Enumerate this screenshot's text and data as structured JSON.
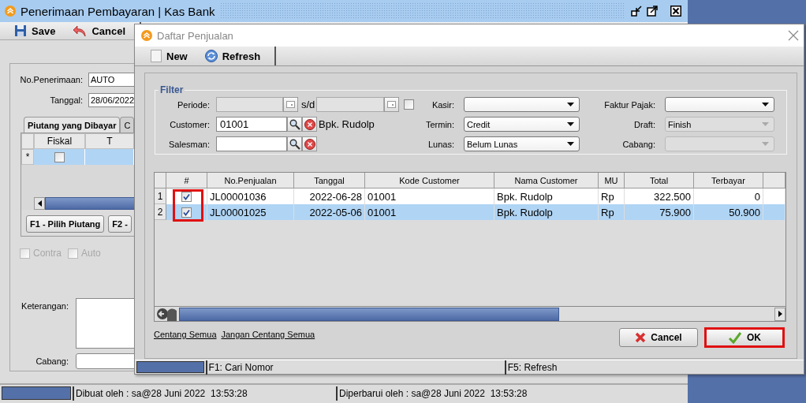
{
  "main_window": {
    "title": "Penerimaan Pembayaran | Kas Bank",
    "toolbar": [
      {
        "kind": "save",
        "label": "Save"
      },
      {
        "kind": "cancel",
        "label": "Cancel"
      }
    ],
    "fields": [
      {
        "label": "No.Penerimaan:",
        "value": "AUTO"
      },
      {
        "label": "Tanggal:",
        "value": "28/06/2022"
      }
    ],
    "tabs": [
      {
        "label": "Piutang yang Dibayar",
        "selected": true
      },
      {
        "label": "C",
        "selected": false
      }
    ],
    "grid": {
      "columns": [
        "Fiskal",
        "T"
      ],
      "rows": [
        {
          "marker": "*",
          "fiskal_checked": false,
          "selected": true
        }
      ]
    },
    "buttons": [
      "F1 - Pilih Piutang",
      "F2 -"
    ],
    "options": [
      {
        "label": "Contra",
        "checked": false,
        "disabled": true
      },
      {
        "label": "Auto",
        "checked": false,
        "disabled": true
      }
    ],
    "keterangan": {
      "label": "Keterangan:"
    },
    "cabang": {
      "label": "Cabang:"
    },
    "status_bar": [
      "Dibuat oleh : sa@28 Juni 2022  13:53:28",
      "Diperbarui oleh : sa@28 Juni 2022  13:53:28"
    ]
  },
  "dialog": {
    "title": "Daftar Penjualan",
    "toolbar": [
      {
        "kind": "new",
        "label": "New"
      },
      {
        "kind": "refresh",
        "label": "Refresh"
      }
    ],
    "filter": {
      "title": "Filter",
      "periode": {
        "label": "Periode:",
        "separator": "s/d",
        "checked": false
      },
      "customer": {
        "label": "Customer:",
        "value": "01001",
        "name": "Bpk. Rudolp"
      },
      "salesman": {
        "label": "Salesman:"
      },
      "combos_middle": [
        {
          "label": "Kasir:",
          "disabled": false
        },
        {
          "label": "Termin:",
          "value": "Credit",
          "disabled": false
        },
        {
          "label": "Lunas:",
          "value": "Belum Lunas",
          "disabled": false
        }
      ],
      "combos_right": [
        {
          "label": "Faktur Pajak:",
          "disabled": false
        },
        {
          "label": "Draft:",
          "value": "Finish",
          "disabled": true
        },
        {
          "label": "Cabang:",
          "disabled": true
        }
      ]
    },
    "table": {
      "check_column": "#",
      "columns": [
        "No.Penjualan",
        "Tanggal",
        "Kode Customer",
        "Nama Customer",
        "MU",
        "Total",
        "Terbayar"
      ],
      "check_column_highlighted": true,
      "rows": [
        {
          "number": "1",
          "checked": true,
          "selected": false,
          "cells": [
            "JL00001036",
            "2022-06-28",
            "01001",
            "Bpk. Rudolp",
            "Rp",
            "322.500",
            "0"
          ]
        },
        {
          "number": "2",
          "checked": true,
          "selected": true,
          "cells": [
            "JL00001025",
            "2022-05-06",
            "01001",
            "Bpk. Rudolp",
            "Rp",
            "75.900",
            "50.900"
          ]
        }
      ]
    },
    "links": [
      "Centang Semua",
      "Jangan Centang Semua"
    ],
    "buttons": [
      {
        "kind": "cancel",
        "label": "Cancel",
        "highlighted": false
      },
      {
        "kind": "ok",
        "label": "OK",
        "highlighted": true
      }
    ],
    "status_bar": [
      "F1: Cari Nomor",
      "F5: Refresh"
    ]
  }
}
